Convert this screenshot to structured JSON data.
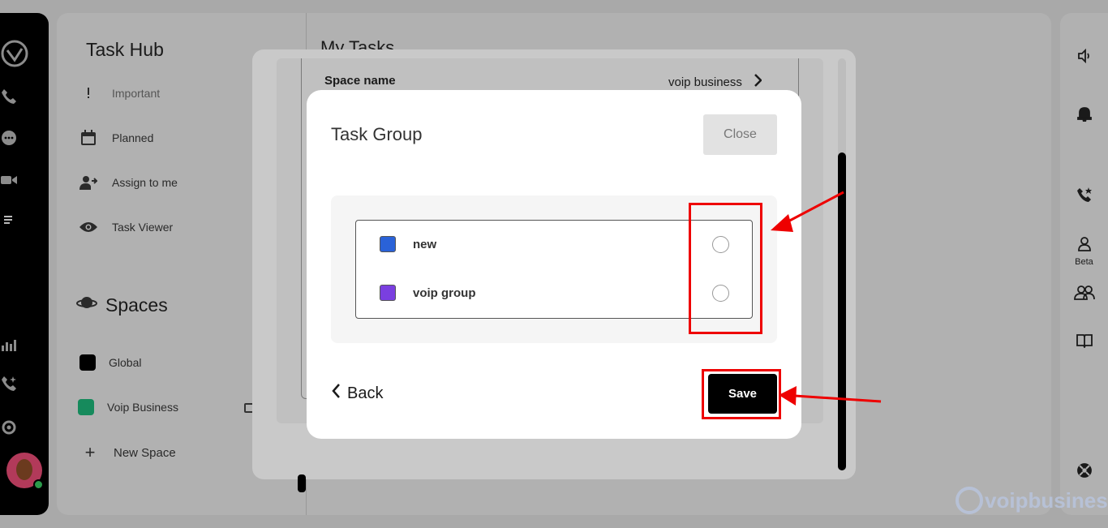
{
  "sidebar_rail": {
    "icons": [
      "logo-icon",
      "phone-icon",
      "chat-icon",
      "video-icon",
      "tasks-icon",
      "analytics-icon",
      "call-sparkle-icon",
      "gear-icon"
    ]
  },
  "task_hub": {
    "title": "Task Hub",
    "items": [
      {
        "label": "Important",
        "icon": "important-icon"
      },
      {
        "label": "Planned",
        "icon": "calendar-icon"
      },
      {
        "label": "Assign to me",
        "icon": "assign-user-icon"
      },
      {
        "label": "Task Viewer",
        "icon": "eye-icon"
      }
    ],
    "spaces_title": "Spaces",
    "spaces": [
      {
        "label": "Global",
        "color": "#000000"
      },
      {
        "label": "Voip Business",
        "color": "#168a5c"
      }
    ],
    "new_space_label": "New Space"
  },
  "main": {
    "heading": "My Tasks"
  },
  "space_dialog": {
    "space_name_label": "Space name",
    "space_name_value": "voip business"
  },
  "task_group_modal": {
    "title": "Task Group",
    "close_label": "Close",
    "groups": [
      {
        "label": "new",
        "color": "#2a62d8",
        "selected": false
      },
      {
        "label": "voip group",
        "color": "#7a3fe0",
        "selected": false
      }
    ],
    "back_label": "Back",
    "save_label": "Save"
  },
  "right_bar": {
    "icons": [
      "speaker-icon",
      "bell-icon",
      "call-star-icon",
      "user-icon",
      "team-icon",
      "book-icon",
      "lifebuoy-icon"
    ],
    "beta_label": "Beta"
  },
  "watermark": {
    "text": "voipbusiness"
  },
  "colors": {
    "annotation": "#ee0000",
    "save_button": "#000000"
  }
}
